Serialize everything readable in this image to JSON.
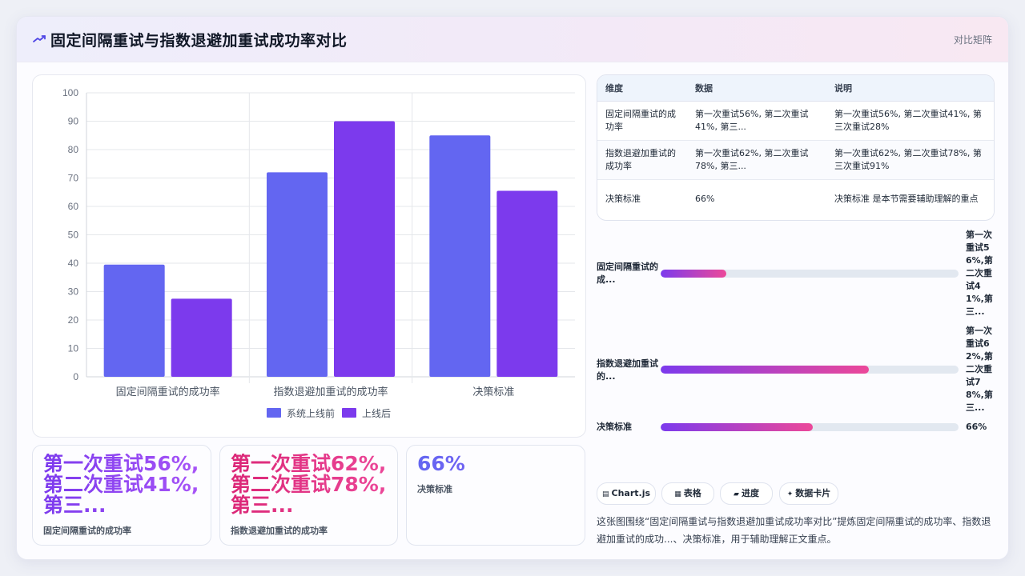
{
  "header": {
    "title": "固定间隔重试与指数退避加重试成功率对比",
    "tag": "对比矩阵"
  },
  "chart_data": {
    "type": "bar",
    "categories": [
      "固定间隔重试的成功率",
      "指数退避加重试的成功率",
      "决策标准"
    ],
    "series": [
      {
        "name": "系统上线前",
        "values": [
          39.5,
          72,
          85
        ],
        "color": "#6366f1"
      },
      {
        "name": "上线后",
        "values": [
          27.5,
          90,
          65.5
        ],
        "color": "#7c3aed"
      }
    ],
    "ylim": [
      0,
      100
    ],
    "yticks": [
      0,
      10,
      20,
      30,
      40,
      50,
      60,
      70,
      80,
      90,
      100
    ],
    "legend": "bottom",
    "grid": true
  },
  "table": {
    "headers": [
      "维度",
      "数据",
      "说明"
    ],
    "rows": [
      {
        "dim": "固定间隔重试的成功率",
        "data": "第一次重试56%, 第二次重试41%, 第三...",
        "note": "第一次重试56%, 第二次重试41%, 第三次重试28%"
      },
      {
        "dim": "指数退避加重试的成功率",
        "data": "第一次重试62%, 第二次重试78%, 第三...",
        "note": "第一次重试62%, 第二次重试78%, 第三次重试91%"
      },
      {
        "dim": "决策标准",
        "data": "66%",
        "note": "决策标准 是本节需要辅助理解的重点"
      }
    ]
  },
  "progress": [
    {
      "label": "固定间隔重试的成...",
      "value_text": "第一次重试56%,第二次重试41%,第三...",
      "fill": 0.22
    },
    {
      "label": "指数退避加重试的...",
      "value_text": "第一次重试62%,第二次重试78%,第三...",
      "fill": 0.7
    },
    {
      "label": "决策标准",
      "value_text": "66%",
      "fill": 0.51
    }
  ],
  "stats": [
    {
      "value": "第一次重试56%,第二次重试41%,第三...",
      "label": "固定间隔重试的成功率",
      "grad_from": "#7c3aed",
      "grad_to": "#a855f7"
    },
    {
      "value": "第一次重试62%,第二次重试78%,第三...",
      "label": "指数退避加重试的成功率",
      "grad_from": "#db2777",
      "grad_to": "#ec4899"
    },
    {
      "value": "66%",
      "label": "决策标准",
      "grad_from": "#6366f1",
      "grad_to": "#8b5cf6"
    }
  ],
  "chips": [
    {
      "icon": "chart-icon",
      "label": "Chart.js"
    },
    {
      "icon": "table-icon",
      "label": "表格"
    },
    {
      "icon": "progress-icon",
      "label": "进度"
    },
    {
      "icon": "sparkle-icon",
      "label": "数据卡片"
    }
  ],
  "description": "这张图围绕“固定间隔重试与指数退避加重试成功率对比”提炼固定间隔重试的成功率、指数退避加重试的成功...、决策标准，用于辅助理解正文重点。",
  "colors": {
    "accent_blue": "#6366f1",
    "accent_purple": "#7c3aed",
    "accent_pink": "#ec4899"
  }
}
